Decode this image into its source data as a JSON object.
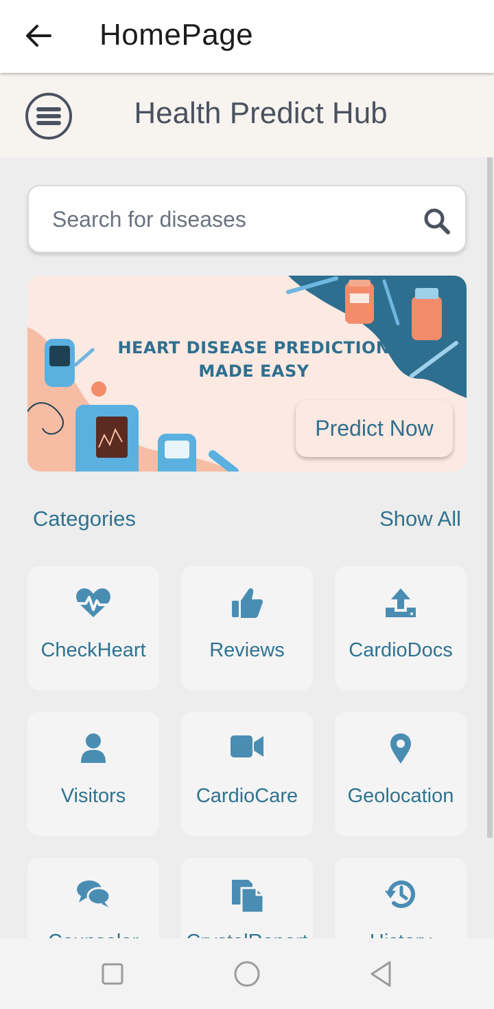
{
  "appbar": {
    "title": "HomePage",
    "back_icon": "arrow-left-icon"
  },
  "header": {
    "title": "Health Predict Hub",
    "menu_icon": "hamburger-menu-icon"
  },
  "search": {
    "placeholder": "Search for diseases",
    "icon": "search-icon"
  },
  "banner": {
    "line1": "HEART DISEASE PREDICTION",
    "line2": "MADE EASY",
    "button_label": "Predict Now"
  },
  "categories": {
    "title": "Categories",
    "show_all": "Show All",
    "items": [
      {
        "label": "CheckHeart",
        "icon": "heartbeat-icon"
      },
      {
        "label": "Reviews",
        "icon": "thumbs-up-icon"
      },
      {
        "label": "CardioDocs",
        "icon": "upload-icon"
      },
      {
        "label": "Visitors",
        "icon": "user-icon"
      },
      {
        "label": "CardioCare",
        "icon": "video-camera-icon"
      },
      {
        "label": "Geolocation",
        "icon": "location-pin-icon"
      },
      {
        "label": "Counselor",
        "icon": "chat-bubbles-icon"
      },
      {
        "label": "CrystalReport",
        "icon": "document-copy-icon"
      },
      {
        "label": "History",
        "icon": "history-icon"
      }
    ]
  },
  "colors": {
    "accent": "#2e7390",
    "icon": "#4a8db3",
    "banner_bg": "#fbe9e2",
    "header_bg": "#f7f3ef"
  },
  "system_nav": {
    "icons": [
      "recent-apps-icon",
      "home-icon",
      "back-triangle-icon"
    ]
  }
}
